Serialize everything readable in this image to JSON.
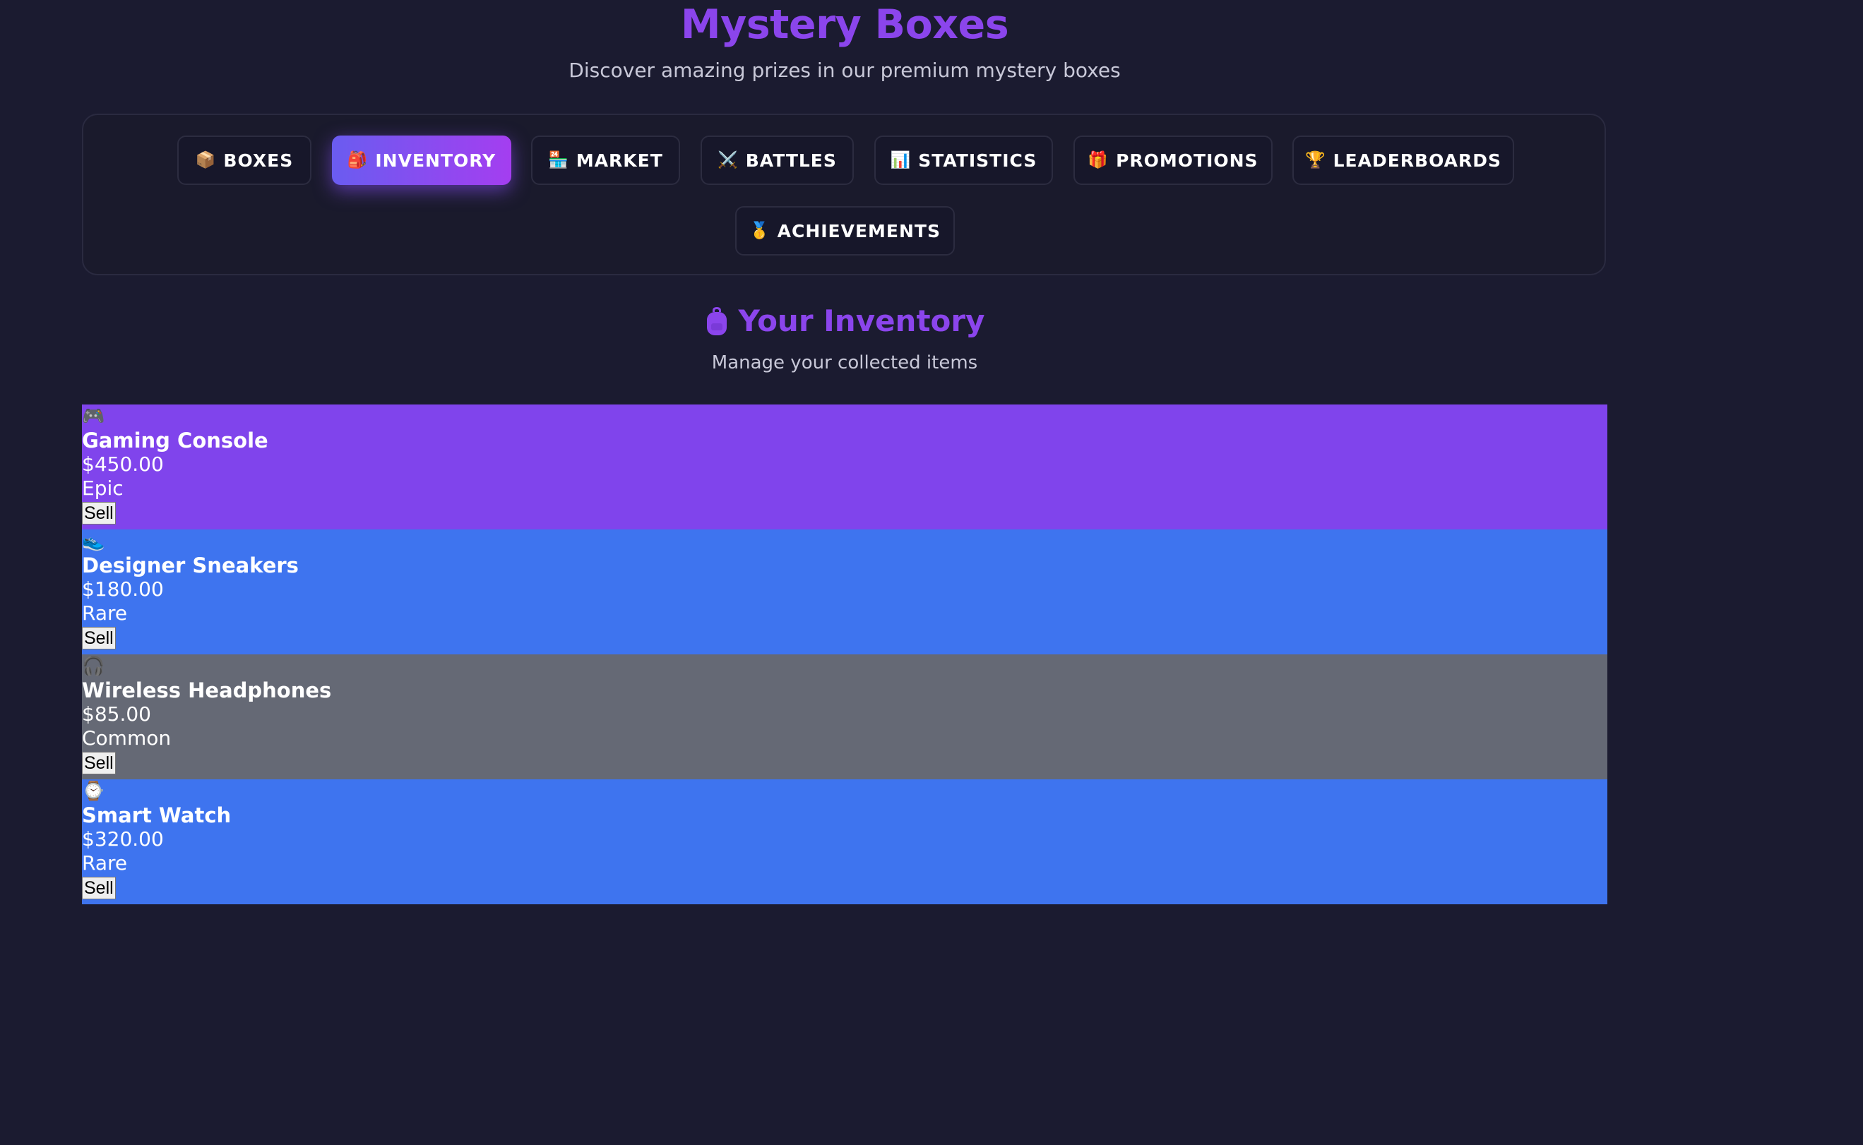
{
  "header": {
    "title": "Mystery Boxes",
    "subtitle": "Discover amazing prizes in our premium mystery boxes"
  },
  "tabs": [
    {
      "icon": "📦",
      "icon_name": "box-icon",
      "label": "BOXES",
      "active": false
    },
    {
      "icon": "🎒",
      "icon_name": "backpack-icon",
      "label": "INVENTORY",
      "active": true
    },
    {
      "icon": "🏪",
      "icon_name": "store-icon",
      "label": "MARKET",
      "active": false
    },
    {
      "icon": "⚔️",
      "icon_name": "swords-icon",
      "label": "BATTLES",
      "active": false
    },
    {
      "icon": "📊",
      "icon_name": "bar-chart-icon",
      "label": "STATISTICS",
      "active": false
    },
    {
      "icon": "🎁",
      "icon_name": "gift-icon",
      "label": "PROMOTIONS",
      "active": false
    },
    {
      "icon": "🏆",
      "icon_name": "trophy-icon",
      "label": "LEADERBOARDS",
      "active": false
    },
    {
      "icon": "🥇",
      "icon_name": "medal-icon",
      "label": "ACHIEVEMENTS",
      "active": false
    }
  ],
  "inventory": {
    "title": "Your Inventory",
    "subtitle": "Manage your collected items",
    "icon_name": "backpack-icon",
    "items": [
      {
        "icon": "🎮",
        "icon_name": "gamepad-icon",
        "name": "Gaming Console",
        "price": "$450.00",
        "rarity": "Epic",
        "color": "#8044ec",
        "sell_label": "Sell"
      },
      {
        "icon": "👟",
        "icon_name": "sneaker-icon",
        "name": "Designer Sneakers",
        "price": "$180.00",
        "rarity": "Rare",
        "color": "#3e74ef",
        "sell_label": "Sell"
      },
      {
        "icon": "🎧",
        "icon_name": "headphones-icon",
        "name": "Wireless Headphones",
        "price": "$85.00",
        "rarity": "Common",
        "color": "#656975",
        "sell_label": "Sell"
      },
      {
        "icon": "⌚",
        "icon_name": "watch-icon",
        "name": "Smart Watch",
        "price": "$320.00",
        "rarity": "Rare",
        "color": "#3e74ef",
        "sell_label": "Sell"
      }
    ]
  },
  "colors": {
    "background": "#1b1b30",
    "accent": "#8b45ec",
    "active_tab_start": "#6a5cf0",
    "active_tab_end": "#a43ef0"
  }
}
